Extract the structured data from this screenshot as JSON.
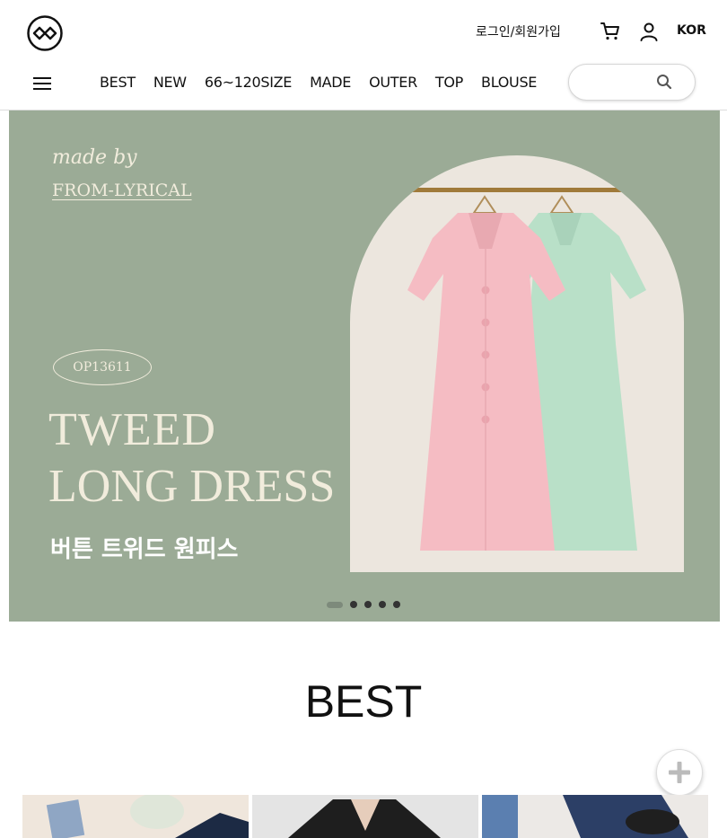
{
  "header": {
    "login_label": "로그인/회원가입",
    "lang_label": "KOR",
    "nav": [
      "BEST",
      "NEW",
      "66~120SIZE",
      "MADE",
      "OUTER",
      "TOP",
      "BLOUSE"
    ],
    "search_placeholder": ""
  },
  "banner": {
    "made_by": "made by",
    "brand": "FROM-LYRICAL",
    "code": "OP13611",
    "title_line1": "TWEED",
    "title_line2": "LONG DRESS",
    "subtitle": "버튼 트위드 원피스",
    "slides_total": 5,
    "active_slide": 1,
    "colors": {
      "background": "#9bab96",
      "text": "#f1ecdc"
    }
  },
  "best": {
    "title": "BEST"
  }
}
